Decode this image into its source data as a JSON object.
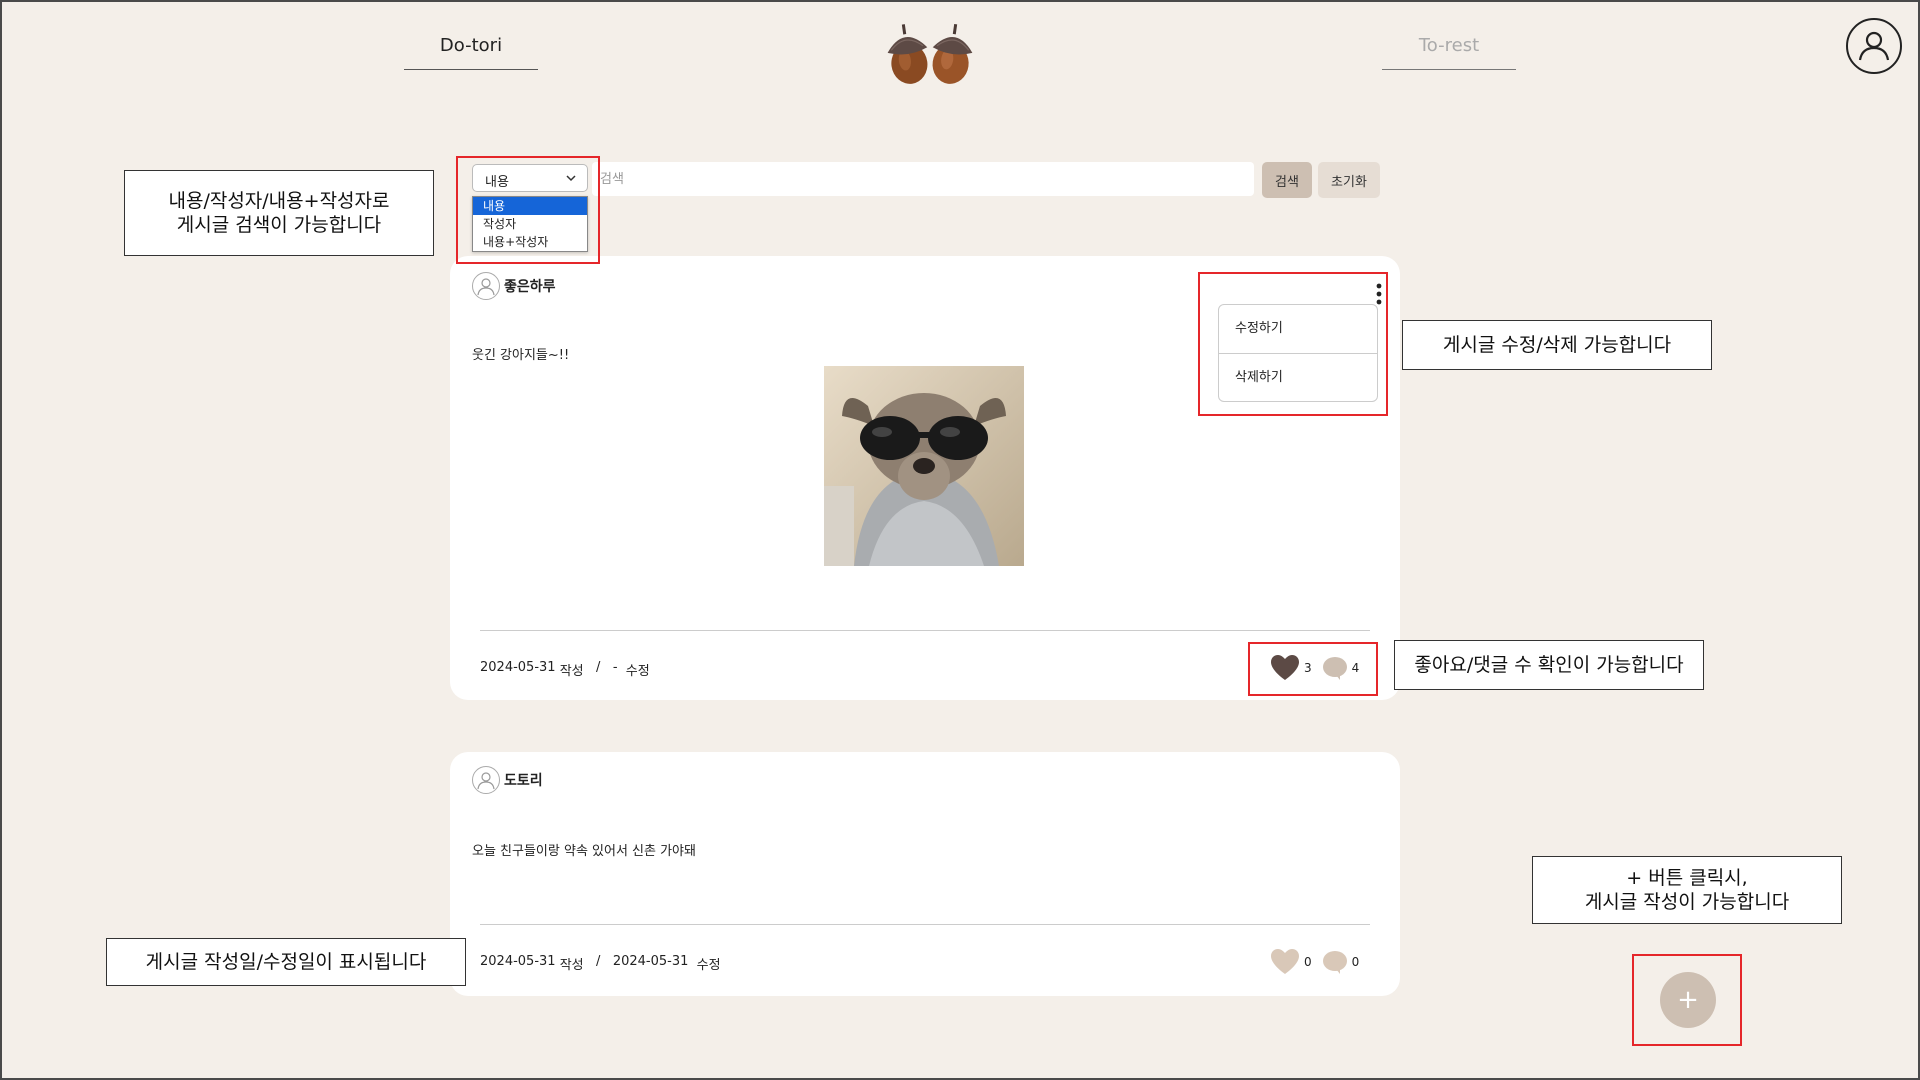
{
  "header": {
    "left_tab": "Do-tori",
    "right_tab": "To-rest",
    "logo_icon": "acorn-icon",
    "profile_icon": "user-icon"
  },
  "search": {
    "selected_option": "내용",
    "options": [
      "내용",
      "작성자",
      "내용+작성자"
    ],
    "placeholder": "검색",
    "search_button": "검색",
    "reset_button": "초기화"
  },
  "posts": [
    {
      "author": "좋은하루",
      "content": "웃긴 강아지들~!!",
      "has_image": true,
      "menu": [
        "수정하기",
        "삭제하기"
      ],
      "created": "2024-05-31",
      "created_suffix": "작성",
      "separator": "/",
      "modified": "-",
      "modified_suffix": "수정",
      "likes": "3",
      "comments": "4",
      "liked": true
    },
    {
      "author": "도토리",
      "content": "오늘 친구들이랑 약속 있어서 신촌 가야돼",
      "has_image": false,
      "created": "2024-05-31",
      "created_suffix": "작성",
      "separator": "/",
      "modified": "2024-05-31",
      "modified_suffix": "수정",
      "likes": "0",
      "comments": "0",
      "liked": false
    }
  ],
  "fab": {
    "label": "+"
  },
  "annotations": {
    "search": "내용/작성자/내용+작성자로\n게시글 검색이 가능합니다",
    "edit": "게시글 수정/삭제 가능합니다",
    "stats": "좋아요/댓글 수 확인이 가능합니다",
    "write": "+ 버튼 클릭시,\n게시글 작성이 가능합니다",
    "dates": "게시글 작성일/수정일이 표시됩니다"
  },
  "colors": {
    "background": "#f4efe9",
    "accent": "#cdbfb2",
    "heart_active": "#5c4a45",
    "heart_inactive": "#d9c8b8",
    "annotation_border": "#e5262a"
  }
}
